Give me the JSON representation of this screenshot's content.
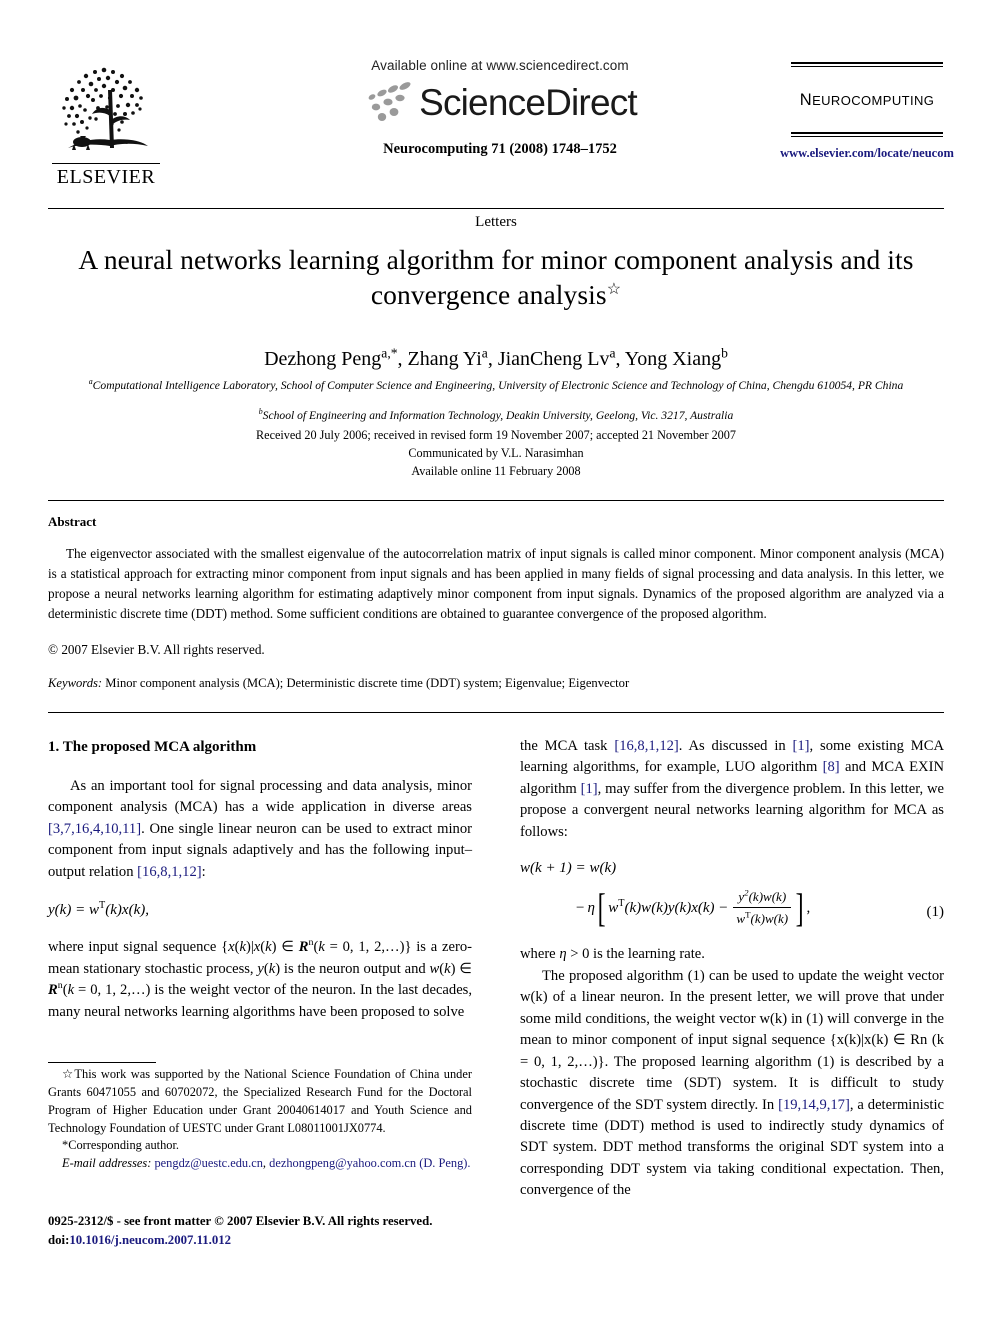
{
  "masthead": {
    "available_online": "Available online at www.sciencedirect.com",
    "sciencedirect_wordmark": "ScienceDirect",
    "elsevier_wordmark": "ELSEVIER",
    "journal_reference": "Neurocomputing 71 (2008) 1748–1752",
    "journal_name": "Neurocomputing",
    "journal_url": "www.elsevier.com/locate/neucom"
  },
  "article": {
    "section_label": "Letters",
    "title": "A neural networks learning algorithm for minor component analysis and its convergence analysis",
    "title_footnote_marker": "☆",
    "authors": "Dezhong Peng, Zhang Yi, JianCheng Lv, Yong Xiang",
    "authors_markup": "Dezhong Peng<sup>a,*</sup>, Zhang Yi<sup>a</sup>, JianCheng Lv<sup>a</sup>, Yong Xiang<sup>b</sup>",
    "affiliation_a": "Computational Intelligence Laboratory, School of Computer Science and Engineering, University of Electronic Science and Technology of China, Chengdu 610054, PR China",
    "affiliation_b": "School of Engineering and Information Technology, Deakin University, Geelong, Vic. 3217, Australia",
    "received": "Received 20 July 2006; received in revised form 19 November 2007; accepted 21 November 2007",
    "communicated_by": "Communicated by V.L. Narasimhan",
    "available_online": "Available online 11 February 2008"
  },
  "abstract": {
    "heading": "Abstract",
    "text": "The eigenvector associated with the smallest eigenvalue of the autocorrelation matrix of input signals is called minor component. Minor component analysis (MCA) is a statistical approach for extracting minor component from input signals and has been applied in many fields of signal processing and data analysis. In this letter, we propose a neural networks learning algorithm for estimating adaptively minor component from input signals. Dynamics of the proposed algorithm are analyzed via a deterministic discrete time (DDT) method. Some sufficient conditions are obtained to guarantee convergence of the proposed algorithm.",
    "copyright": "© 2007 Elsevier B.V. All rights reserved.",
    "keywords_label": "Keywords:",
    "keywords": "Minor component analysis (MCA); Deterministic discrete time (DDT) system; Eigenvalue; Eigenvector"
  },
  "body": {
    "section1_heading": "1. The proposed MCA algorithm",
    "left_para1_a": "As an important tool for signal processing and data analysis, minor component analysis (MCA) has a wide application in diverse areas ",
    "left_para1_cite1": "[3,7,16,4,10,11]",
    "left_para1_b": ". One single linear neuron can be used to extract minor component from input signals adaptively and has the following input–output relation ",
    "left_para1_cite2": "[16,8,1,12]",
    "left_para1_c": ":",
    "equation_y": "y(k) = wT(k)x(k),",
    "left_para2": "where input signal sequence {x(k)|x(k) ∈ Rn(k = 0, 1, 2,…)} is a zero-mean stationary stochastic process, y(k) is the neuron output and w(k) ∈ Rn(k = 0, 1, 2,…) is the weight vector of the neuron. In the last decades, many neural networks learning algorithms have been proposed to solve",
    "right_para1_a": "the MCA task ",
    "right_para1_cite1": "[16,8,1,12]",
    "right_para1_b": ". As discussed in ",
    "right_para1_cite2": "[1]",
    "right_para1_c": ", some existing MCA learning algorithms, for example, LUO algorithm ",
    "right_para1_cite3": "[8]",
    "right_para1_d": " and MCA EXIN algorithm ",
    "right_para1_cite4": "[1]",
    "right_para1_e": ", may suffer from the divergence problem. In this letter, we propose a convergent neural networks learning algorithm for MCA as follows:",
    "equation1_line1": "w(k + 1) = w(k)",
    "equation1_number": "(1)",
    "eq1_eta": "− η",
    "eq1_term1": "wT(k)w(k)y(k)x(k) −",
    "eq1_frac_num": "y2(k)w(k)",
    "eq1_frac_den": "wT(k)w(k)",
    "eq1_tail": ",",
    "right_para2": "where η > 0 is the learning rate.",
    "right_para3_a": "The proposed algorithm (1) can be used to update the weight vector w(k) of a linear neuron. In the present letter, we will prove that under some mild conditions, the weight vector w(k) in (1) will converge in the mean to minor component of input signal sequence {x(k)|x(k) ∈ Rn (k = 0, 1, 2,…)}. The proposed learning algorithm (1) is described by a stochastic discrete time (SDT) system. It is difficult to study convergence of the SDT system directly. In ",
    "right_para3_cite": "[19,14,9,17]",
    "right_para3_b": ", a deterministic discrete time (DDT) method is used to indirectly study dynamics of SDT system. DDT method transforms the original SDT system into a corresponding DDT system via taking conditional expectation. Then, convergence of the"
  },
  "footnote": {
    "funding": "☆This work was supported by the National Science Foundation of China under Grants 60471055 and 60702072, the Specialized Research Fund for the Doctoral Program of Higher Education under Grant 20040614017 and Youth Science and Technology Foundation of UESTC under Grant L08011001JX0774.",
    "corresponding": "*Corresponding author.",
    "email_label": "E-mail addresses:",
    "email1": "pengdz@uestc.edu.cn",
    "email_sep": ", ",
    "email2": "dezhongpeng@yahoo.com.cn",
    "email_owner": "(D. Peng)."
  },
  "footer": {
    "copyright_line": "0925-2312/$ - see front matter © 2007 Elsevier B.V. All rights reserved.",
    "doi_label": "doi:",
    "doi_value": "10.1016/j.neucom.2007.11.012"
  },
  "colors": {
    "link": "#1a1a7e",
    "text": "#000000",
    "background": "#ffffff"
  }
}
